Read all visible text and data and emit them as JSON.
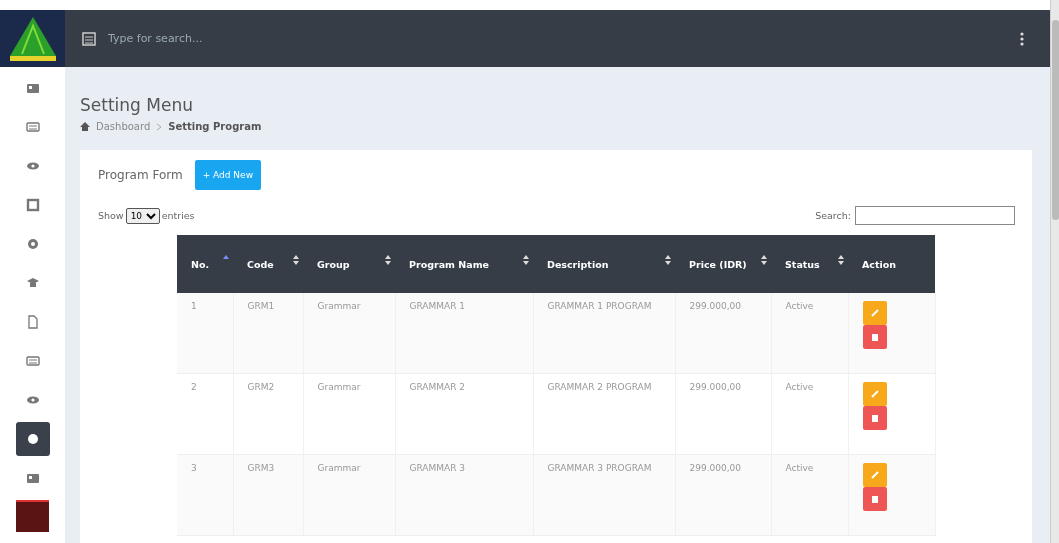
{
  "topbar": {
    "search": {
      "placeholder": "Type for search..."
    }
  },
  "sidebar": {
    "items": [
      {
        "kind": "card",
        "selected": false
      },
      {
        "kind": "keyboard",
        "selected": false
      },
      {
        "kind": "eye",
        "selected": false
      },
      {
        "kind": "square",
        "selected": false
      },
      {
        "kind": "gear",
        "selected": false
      },
      {
        "kind": "cap",
        "selected": false
      },
      {
        "kind": "file",
        "selected": false
      },
      {
        "kind": "keyboard",
        "selected": false
      },
      {
        "kind": "eye",
        "selected": false
      },
      {
        "kind": "gear",
        "selected": true
      },
      {
        "kind": "card",
        "selected": false
      }
    ]
  },
  "page": {
    "title": "Setting Menu",
    "breadcrumb": [
      {
        "label": "Dashboard",
        "current": false
      },
      {
        "label": "Setting Program",
        "current": true
      }
    ]
  },
  "card": {
    "title": "Program Form",
    "add_button": "+ Add New",
    "length": {
      "before": "Show",
      "value": "10",
      "after": "entries"
    },
    "search_label": "Search:",
    "table": {
      "columns": [
        {
          "label": "No.",
          "sortable": true,
          "sorted": true
        },
        {
          "label": "Code",
          "sortable": true,
          "sorted": false
        },
        {
          "label": "Group",
          "sortable": true,
          "sorted": false
        },
        {
          "label": "Program Name",
          "sortable": true,
          "sorted": false
        },
        {
          "label": "Description",
          "sortable": true,
          "sorted": false
        },
        {
          "label": "Price (IDR)",
          "sortable": true,
          "sorted": false
        },
        {
          "label": "Status",
          "sortable": true,
          "sorted": false
        },
        {
          "label": "Action",
          "sortable": false
        }
      ],
      "rows": [
        {
          "cells": [
            "1",
            "GRM1",
            "Grammar",
            "GRAMMAR 1",
            "GRAMMAR 1 PROGRAM",
            "299.000,00",
            "Active"
          ]
        },
        {
          "cells": [
            "2",
            "GRM2",
            "Grammar",
            "GRAMMAR 2",
            "GRAMMAR 2 PROGRAM",
            "299.000,00",
            "Active"
          ]
        },
        {
          "cells": [
            "3",
            "GRM3",
            "Grammar",
            "GRAMMAR 3",
            "GRAMMAR 3 PROGRAM",
            "299.000,00",
            "Active"
          ]
        }
      ]
    }
  }
}
